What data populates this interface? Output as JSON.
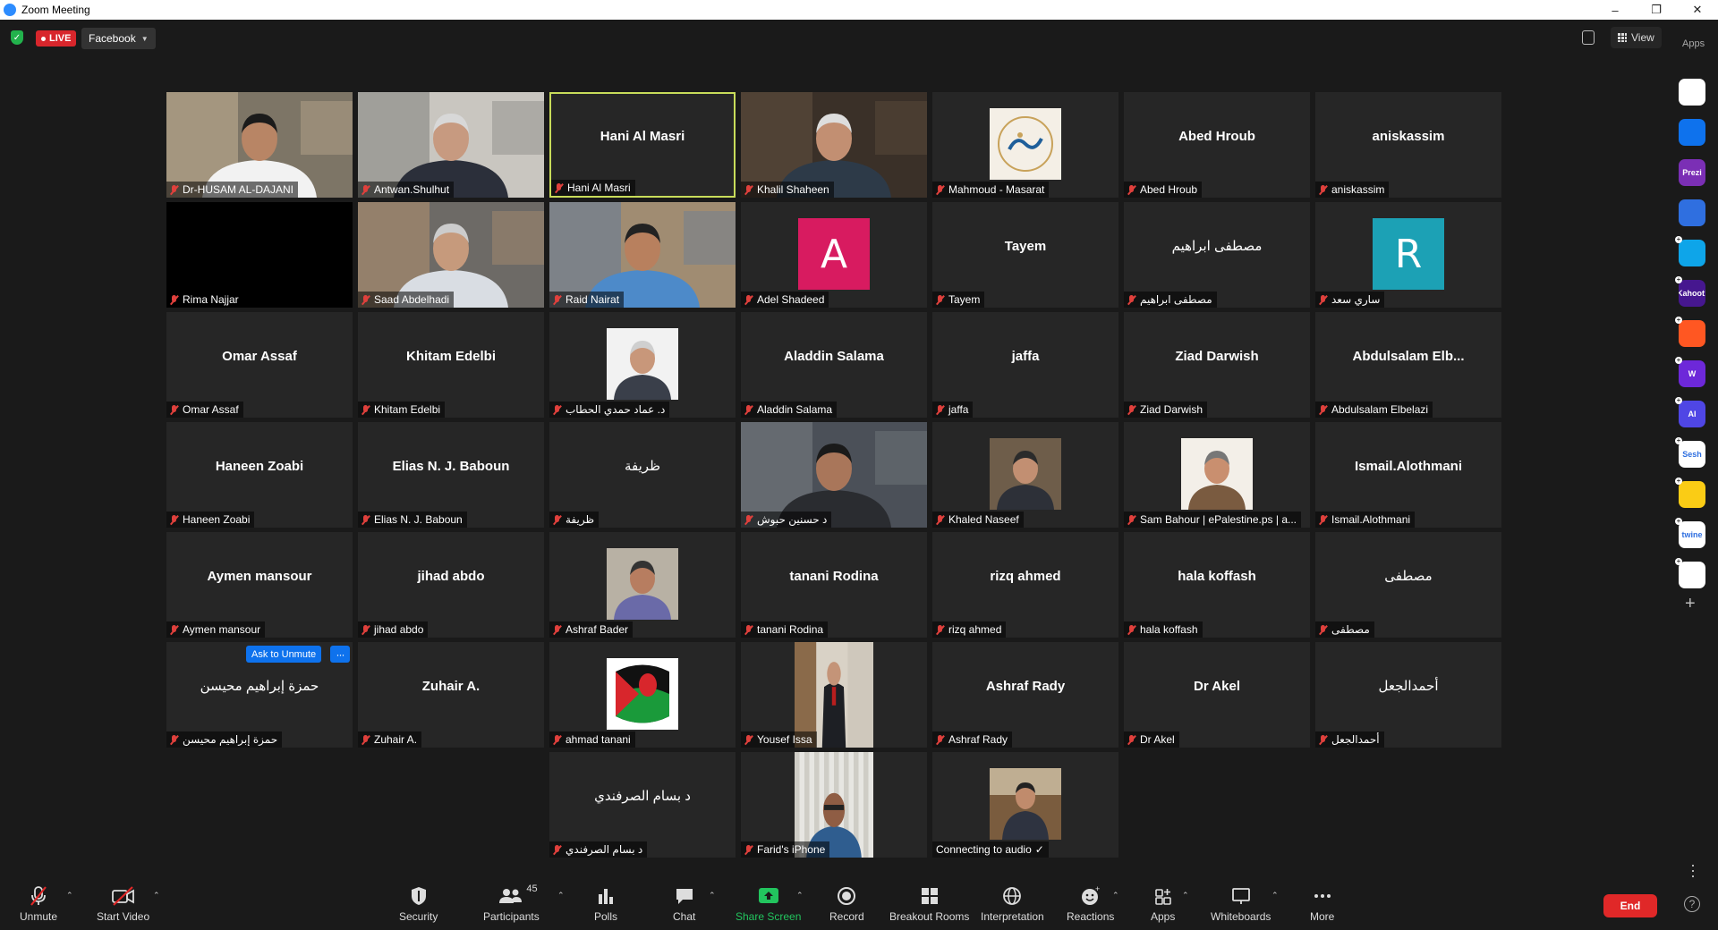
{
  "window": {
    "title": "Zoom Meeting"
  },
  "topbar": {
    "live_label": "LIVE",
    "live_platform": "Facebook",
    "view_label": "View",
    "apps_label": "Apps"
  },
  "participants": [
    {
      "name": "Dr-HUSAM AL-DAJANI",
      "type": "video"
    },
    {
      "name": "Antwan.Shulhut",
      "type": "video"
    },
    {
      "name": "Hani Al Masri",
      "display": "Hani Al Masri",
      "type": "name",
      "speaking": true
    },
    {
      "name": "Khalil Shaheen",
      "type": "video"
    },
    {
      "name": "Mahmoud - Masarat",
      "type": "thumb",
      "thumb": "logo"
    },
    {
      "name": "Abed Hroub",
      "display": "Abed Hroub",
      "type": "name"
    },
    {
      "name": "aniskassim",
      "display": "aniskassim",
      "type": "name"
    },
    {
      "name": "Rima Najjar",
      "type": "black"
    },
    {
      "name": "Saad Abdelhadi",
      "type": "video"
    },
    {
      "name": "Raid Nairat",
      "type": "video"
    },
    {
      "name": "Adel Shadeed",
      "type": "letter",
      "letter": "A",
      "color": "#d81b60"
    },
    {
      "name": "Tayem",
      "display": "Tayem",
      "type": "name"
    },
    {
      "name": "مصطفى ابراهيم",
      "display": "مصطفى ابراهيم",
      "type": "name",
      "light": true
    },
    {
      "name": "ساري سعد",
      "type": "letter",
      "letter": "R",
      "color": "#1ca1b5"
    },
    {
      "name": "Omar Assaf",
      "display": "Omar Assaf",
      "type": "name"
    },
    {
      "name": "Khitam Edelbi",
      "display": "Khitam Edelbi",
      "type": "name"
    },
    {
      "name": "د. عماد حمدي الحطاب",
      "type": "thumb",
      "thumb": "portrait"
    },
    {
      "name": "Aladdin Salama",
      "display": "Aladdin Salama",
      "type": "name"
    },
    {
      "name": "jaffa",
      "display": "jaffa",
      "type": "name"
    },
    {
      "name": "Ziad Darwish",
      "display": "Ziad Darwish",
      "type": "name"
    },
    {
      "name": "Abdulsalam Elbelazi",
      "display": "Abdulsalam  Elb...",
      "type": "name"
    },
    {
      "name": "Haneen Zoabi",
      "display": "Haneen Zoabi",
      "type": "name"
    },
    {
      "name": "Elias N. J. Baboun",
      "display": "Elias N. J. Baboun",
      "type": "name"
    },
    {
      "name": "ظريفة",
      "display": "ظريفة",
      "type": "name",
      "light": true
    },
    {
      "name": "د حسنين حبوش",
      "type": "video"
    },
    {
      "name": "Khaled Naseef",
      "type": "thumb",
      "thumb": "suit"
    },
    {
      "name": "Sam Bahour | ePalestine.ps | a...",
      "type": "thumb",
      "thumb": "bald"
    },
    {
      "name": "Ismail.Alothmani",
      "display": "Ismail.Alothmani",
      "type": "name"
    },
    {
      "name": "Aymen mansour",
      "display": "Aymen mansour",
      "type": "name"
    },
    {
      "name": "jihad abdo",
      "display": "jihad abdo",
      "type": "name"
    },
    {
      "name": "Ashraf Bader",
      "type": "thumb",
      "thumb": "office"
    },
    {
      "name": "tanani Rodina",
      "display": "tanani Rodina",
      "type": "name"
    },
    {
      "name": "rizq ahmed",
      "display": "rizq ahmed",
      "type": "name"
    },
    {
      "name": "hala koffash",
      "display": "hala koffash",
      "type": "name"
    },
    {
      "name": "مصطفى",
      "display": "مصطفى",
      "type": "name",
      "light": true
    },
    {
      "name": "حمزة إبراهيم محيسن",
      "display": "حمزة إبراهيم محيسن",
      "type": "name",
      "light": true
    },
    {
      "name": "Zuhair A.",
      "display": "Zuhair A.",
      "type": "name"
    },
    {
      "name": "ahmad tanani",
      "type": "thumb",
      "thumb": "flag"
    },
    {
      "name": "Yousef Issa",
      "type": "thumb",
      "thumb": "standing",
      "wide": true
    },
    {
      "name": "Ashraf Rady",
      "display": "Ashraf Rady",
      "type": "name"
    },
    {
      "name": "Dr Akel",
      "display": "Dr Akel",
      "type": "name"
    },
    {
      "name": "أحمدالجعل",
      "display": "أحمدالجعل",
      "type": "name",
      "light": true
    },
    {
      "name": "د  بسام الصرفندي",
      "display": "د  بسام الصرفندي",
      "type": "name",
      "light": true
    },
    {
      "name": "Farid's iPhone",
      "type": "thumb",
      "thumb": "curtain",
      "wide": true
    },
    {
      "name": "Connecting to audio",
      "type": "thumb",
      "thumb": "desk",
      "connecting": true,
      "status_mark": "✓"
    }
  ],
  "tile_actions": {
    "ask_to_unmute": "Ask to Unmute",
    "more": "···"
  },
  "toolbar": {
    "unmute": "Unmute",
    "start_video": "Start Video",
    "security": "Security",
    "participants": "Participants",
    "participants_count": "45",
    "polls": "Polls",
    "chat": "Chat",
    "share_screen": "Share Screen",
    "record": "Record",
    "breakout_rooms": "Breakout Rooms",
    "interpretation": "Interpretation",
    "reactions": "Reactions",
    "apps": "Apps",
    "whiteboards": "Whiteboards",
    "more": "More",
    "end": "End"
  },
  "apps_rail": [
    {
      "name": "clipboard-app",
      "color": "#ffffff",
      "label": ""
    },
    {
      "name": "camera-app",
      "color": "#0e72ed",
      "label": ""
    },
    {
      "name": "prezi-app",
      "color": "#7b2fb5",
      "label": "Prezi"
    },
    {
      "name": "timer-app",
      "color": "#2f6fe0",
      "label": ""
    },
    {
      "name": "pitch-app",
      "color": "#0ea5e9",
      "label": ""
    },
    {
      "name": "kahoot-app",
      "color": "#46178f",
      "label": "Kahoot!"
    },
    {
      "name": "orange-app",
      "color": "#ff5722",
      "label": ""
    },
    {
      "name": "wooclap-app",
      "color": "#6d28d9",
      "label": "W"
    },
    {
      "name": "ai-app",
      "color": "#4f46e5",
      "label": "AI"
    },
    {
      "name": "sesh-app",
      "color": "#ffffff",
      "label": "Sesh"
    },
    {
      "name": "emoji-app",
      "color": "#facc15",
      "label": ""
    },
    {
      "name": "twine-app",
      "color": "#ffffff",
      "label": "twine"
    },
    {
      "name": "grid-app",
      "color": "#ffffff",
      "label": ""
    }
  ]
}
